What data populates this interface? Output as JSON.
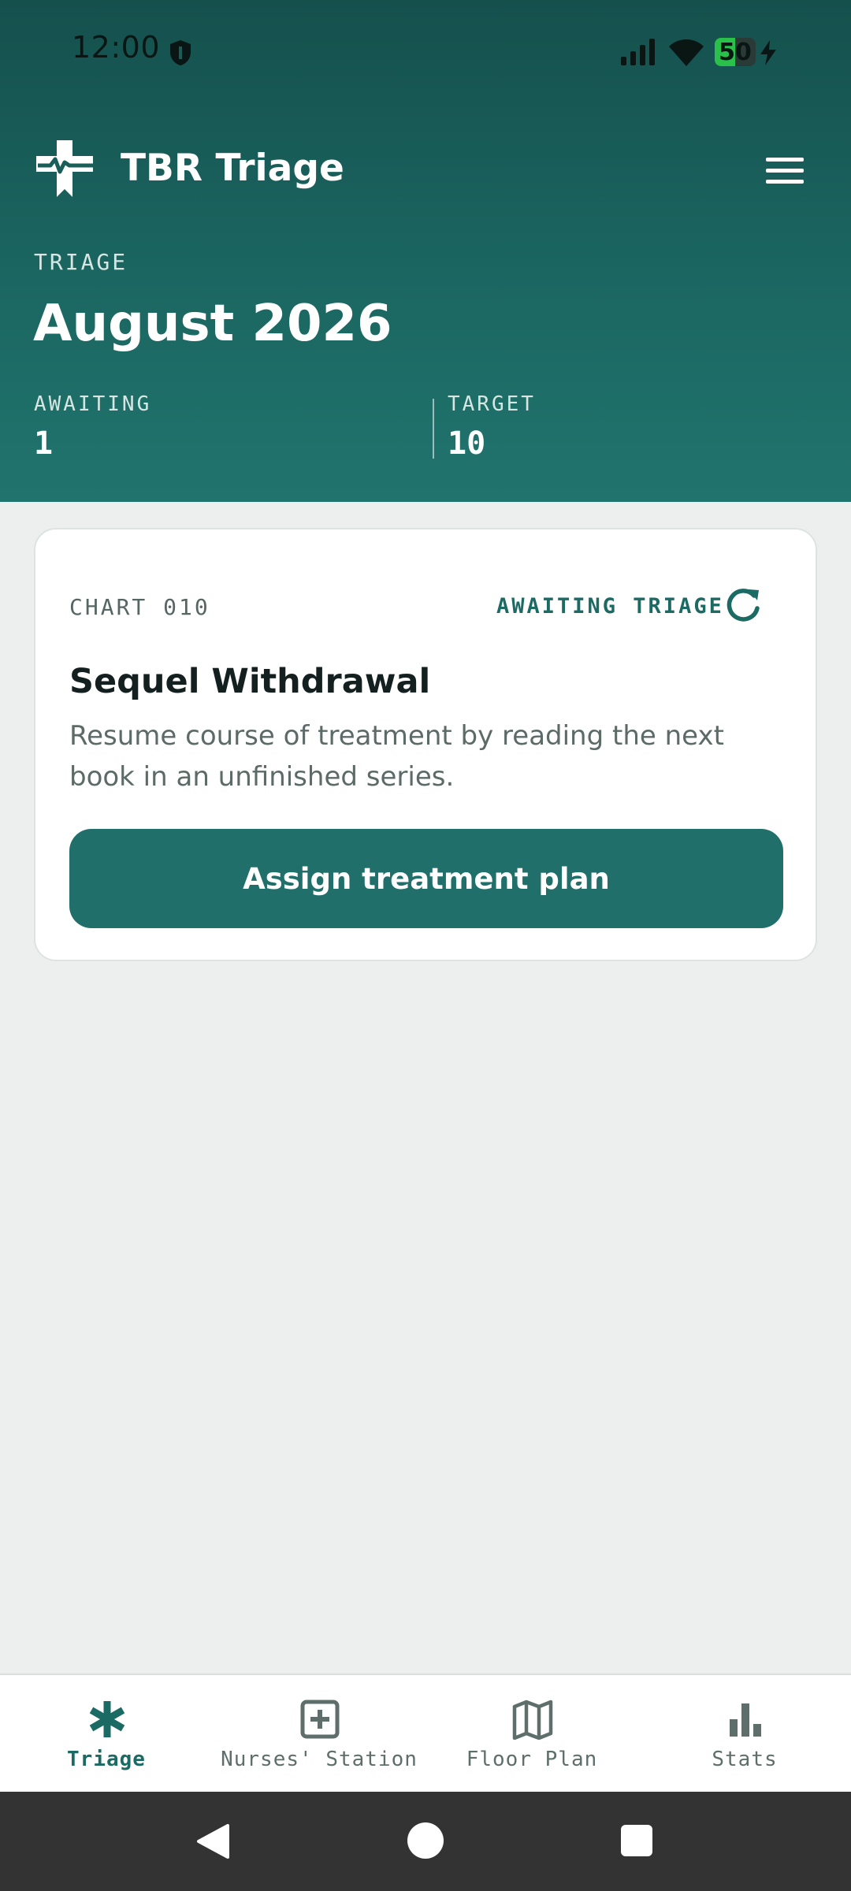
{
  "status_bar": {
    "time": "12:00",
    "battery_percent": "50",
    "battery_level": 0.5,
    "icons": [
      "shield-icon",
      "signal-icon",
      "wifi-icon",
      "battery-icon",
      "charging-icon"
    ]
  },
  "app_bar": {
    "title": "TBR Triage",
    "logo_icon": "medical-cross-heartbeat-icon",
    "menu_icon": "hamburger-menu-icon"
  },
  "header": {
    "eyebrow": "TRIAGE",
    "month": "August 2026",
    "stats": [
      {
        "label": "AWAITING",
        "value": "1"
      },
      {
        "label": "TARGET",
        "value": "10"
      }
    ]
  },
  "card": {
    "chart_id": "CHART 010",
    "status": "AWAITING TRIAGE",
    "refresh_icon": "refresh-icon",
    "title": "Sequel Withdrawal",
    "description": "Resume course of treatment by reading the next book in an unfinished series.",
    "action_label": "Assign treatment plan"
  },
  "bottom_nav": {
    "items": [
      {
        "label": "Triage",
        "icon": "asterisk-icon",
        "active": true
      },
      {
        "label": "Nurses' Station",
        "icon": "plus-square-icon",
        "active": false
      },
      {
        "label": "Floor Plan",
        "icon": "map-icon",
        "active": false
      },
      {
        "label": "Stats",
        "icon": "bar-chart-icon",
        "active": false
      }
    ]
  },
  "colors": {
    "header_dark": "#15504D",
    "header_light": "#21746E",
    "accent": "#206F6A",
    "background": "#ECEFEE",
    "battery_green": "#29C14A"
  }
}
